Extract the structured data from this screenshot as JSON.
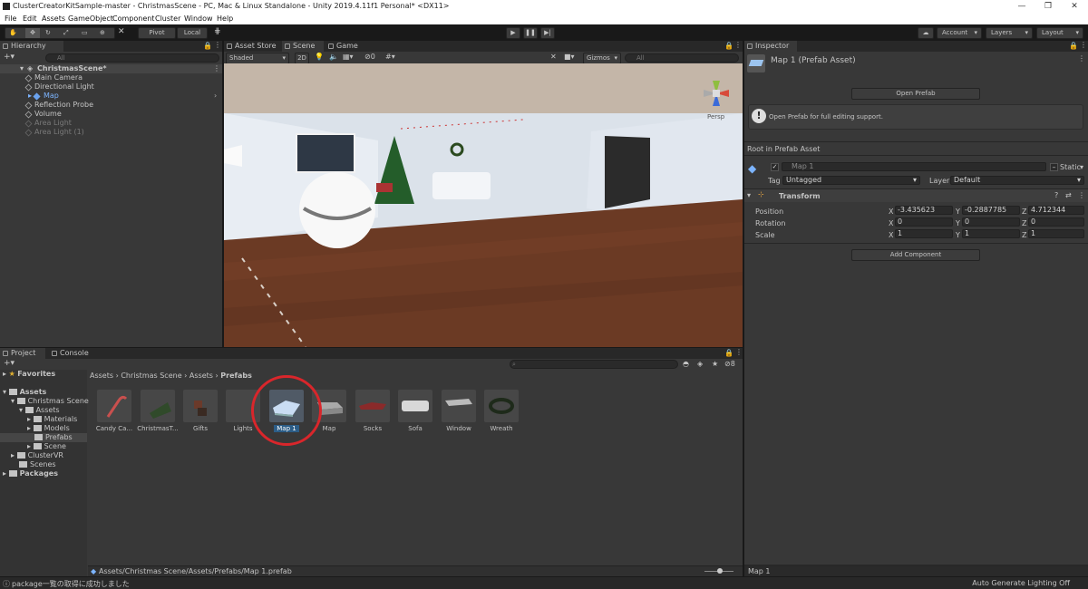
{
  "window": {
    "title": "ClusterCreatorKitSample-master - ChristmasScene - PC, Mac & Linux Standalone - Unity 2019.4.11f1 Personal* <DX11>"
  },
  "menu": [
    "File",
    "Edit",
    "Assets",
    "GameObject",
    "Component",
    "Cluster",
    "Window",
    "Help"
  ],
  "toolbar": {
    "pivot": "Pivot",
    "local": "Local",
    "account": "Account",
    "layers": "Layers",
    "layout": "Layout"
  },
  "hierarchy": {
    "tab": "Hierarchy",
    "search_placeholder": "All",
    "scene": "ChristmasScene*",
    "items": [
      "Main Camera",
      "Directional Light",
      "Map",
      "Reflection Probe",
      "Volume",
      "Area Light",
      "Area Light (1)"
    ]
  },
  "scene_view": {
    "tabs": [
      "Asset Store",
      "Scene",
      "Game"
    ],
    "shading": "Shaded",
    "mode_2d": "2D",
    "hidden_count": "0",
    "gizmos": "Gizmos",
    "search_placeholder": "All",
    "persp": "Persp"
  },
  "inspector": {
    "tab": "Inspector",
    "title": "Map 1 (Prefab Asset)",
    "open_prefab": "Open Prefab",
    "info": "Open Prefab for full editing support.",
    "root_label": "Root in Prefab Asset",
    "object_name": "Map 1",
    "static_label": "Static",
    "tag_label": "Tag",
    "tag_value": "Untagged",
    "layer_label": "Layer",
    "layer_value": "Default",
    "transform": "Transform",
    "position_label": "Position",
    "rotation_label": "Rotation",
    "scale_label": "Scale",
    "position": {
      "x": "-3.435623",
      "y": "-0.2887785",
      "z": "4.712344"
    },
    "rotation": {
      "x": "0",
      "y": "0",
      "z": "0"
    },
    "scale": {
      "x": "1",
      "y": "1",
      "z": "1"
    },
    "add_component": "Add Component",
    "footer": "Map 1"
  },
  "project": {
    "tabs": [
      "Project",
      "Console"
    ],
    "favorites": "Favorites",
    "tree": [
      "Assets",
      "Christmas Scene",
      "Assets",
      "Materials",
      "Models",
      "Prefabs",
      "Scene",
      "ClusterVR",
      "Scenes",
      "Packages"
    ],
    "breadcrumb": [
      "Assets",
      "Christmas Scene",
      "Assets",
      "Prefabs"
    ],
    "hidden_count": "8",
    "assets": [
      "Candy Ca...",
      "ChristmasT...",
      "Gifts",
      "Lights",
      "Map 1",
      "Map",
      "Socks",
      "Sofa",
      "Window",
      "Wreath"
    ],
    "path": "Assets/Christmas Scene/Assets/Prefabs/Map 1.prefab"
  },
  "status": {
    "message": "package一覧の取得に成功しました",
    "lighting": "Auto Generate Lighting Off"
  },
  "colors": {
    "selection": "#2c5d87",
    "highlight_circle": "#d9262b",
    "accent_blue": "#3a72b0"
  }
}
